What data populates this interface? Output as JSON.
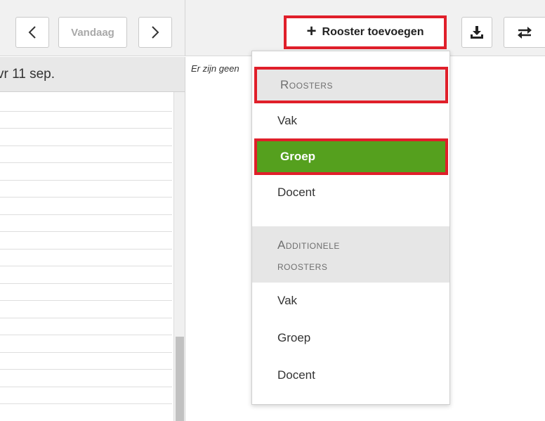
{
  "toolbar": {
    "today_label": "Vandaag",
    "add_schedule_label": "Rooster toevoegen",
    "highlight_color": "#e01f2a"
  },
  "calendar": {
    "day_header": "vr 11 sep.",
    "empty_message": "Er zijn geen"
  },
  "dropdown": {
    "section_roosters": "Roosters",
    "roosters_items": [
      {
        "label": "Vak"
      },
      {
        "label": "Groep",
        "selected": true,
        "color": "#55a01e"
      },
      {
        "label": "Docent"
      }
    ],
    "section_additionele": [
      "Additionele",
      "roosters"
    ],
    "additionele_items": [
      {
        "label": "Vak"
      },
      {
        "label": "Groep"
      },
      {
        "label": "Docent"
      }
    ]
  }
}
